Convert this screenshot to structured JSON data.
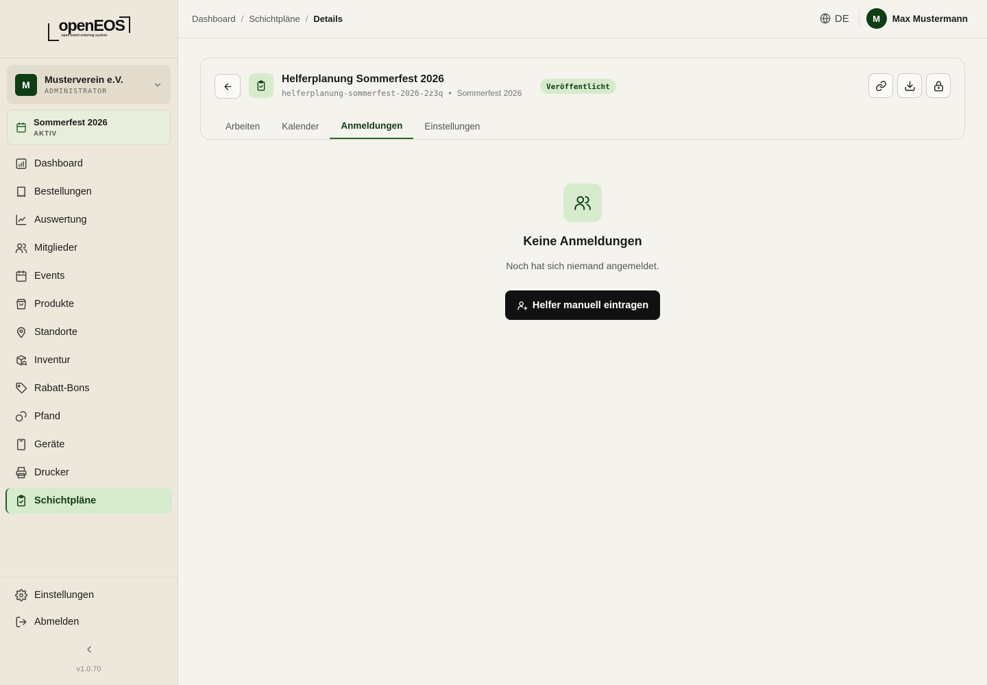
{
  "brand": {
    "logo_word": "openEOS",
    "logo_tagline": "open event ordering system",
    "accent": "#0f3d14",
    "accent_light": "#d6ebcc"
  },
  "organization": {
    "initial": "M",
    "name": "Musterverein e.V.",
    "role": "ADMINISTRATOR"
  },
  "event": {
    "name": "Sommerfest 2026",
    "status": "AKTIV"
  },
  "sidebar": {
    "items": [
      {
        "label": "Dashboard",
        "icon": "dashboard-icon"
      },
      {
        "label": "Bestellungen",
        "icon": "receipt-icon"
      },
      {
        "label": "Auswertung",
        "icon": "chart-line-icon"
      },
      {
        "label": "Mitglieder",
        "icon": "users-icon"
      },
      {
        "label": "Events",
        "icon": "calendar-icon"
      },
      {
        "label": "Produkte",
        "icon": "shopping-bag-icon"
      },
      {
        "label": "Standorte",
        "icon": "map-pin-icon"
      },
      {
        "label": "Inventur",
        "icon": "package-search-icon"
      },
      {
        "label": "Rabatt-Bons",
        "icon": "tag-icon"
      },
      {
        "label": "Pfand",
        "icon": "coins-icon"
      },
      {
        "label": "Geräte",
        "icon": "tablet-icon"
      },
      {
        "label": "Drucker",
        "icon": "printer-icon"
      },
      {
        "label": "Schichtpläne",
        "icon": "clipboard-check-icon",
        "active": true
      }
    ],
    "settings": "Einstellungen",
    "logout": "Abmelden",
    "version": "v1.0.70"
  },
  "breadcrumb": {
    "items": [
      "Dashboard",
      "Schichtpläne"
    ],
    "current": "Details"
  },
  "topbar": {
    "language": "DE",
    "user_initial": "M",
    "user_name": "Max Mustermann"
  },
  "plan": {
    "title": "Helferplanung Sommerfest 2026",
    "slug": "helferplanung-sommerfest-2026-2z3q",
    "separator": "•",
    "event": "Sommerfest 2026",
    "status": "Veröffentlicht"
  },
  "tabs": [
    {
      "label": "Arbeiten"
    },
    {
      "label": "Kalender"
    },
    {
      "label": "Anmeldungen",
      "active": true
    },
    {
      "label": "Einstellungen"
    }
  ],
  "empty_state": {
    "title": "Keine Anmeldungen",
    "text": "Noch hat sich niemand angemeldet.",
    "button": "Helfer manuell eintragen"
  }
}
